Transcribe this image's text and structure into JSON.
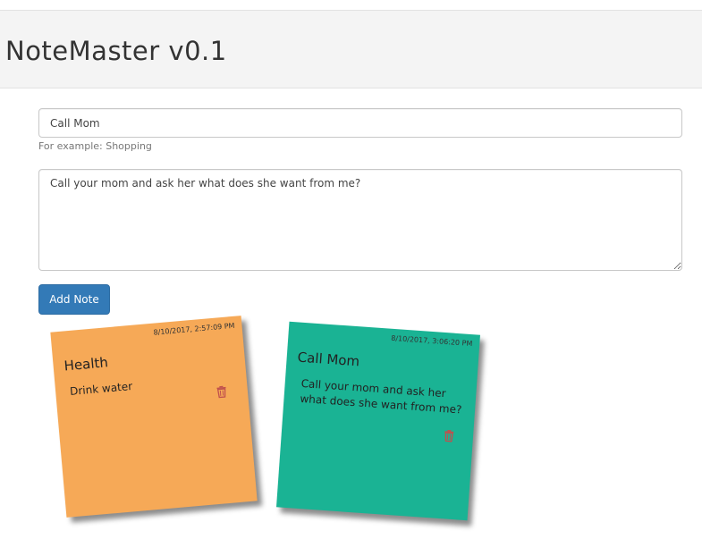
{
  "app": {
    "title": "NoteMaster v0.1"
  },
  "form": {
    "title_value": "Call Mom",
    "help_text": "For example: Shopping",
    "body_value": "Call your mom and ask her what does she want from me?",
    "add_label": "Add Note"
  },
  "notes": [
    {
      "date": "8/10/2017, 2:57:09 PM",
      "title": "Health",
      "body": "Drink water",
      "color": "#f6a957",
      "icon": "trash-icon"
    },
    {
      "date": "8/10/2017, 3:06:20 PM",
      "title": "Call Mom",
      "body": "Call your mom and ask her what does she want from me?",
      "color": "#1ab394",
      "icon": "trash-icon"
    }
  ],
  "colors": {
    "primary": "#337ab7",
    "trash": "#c0504d"
  }
}
